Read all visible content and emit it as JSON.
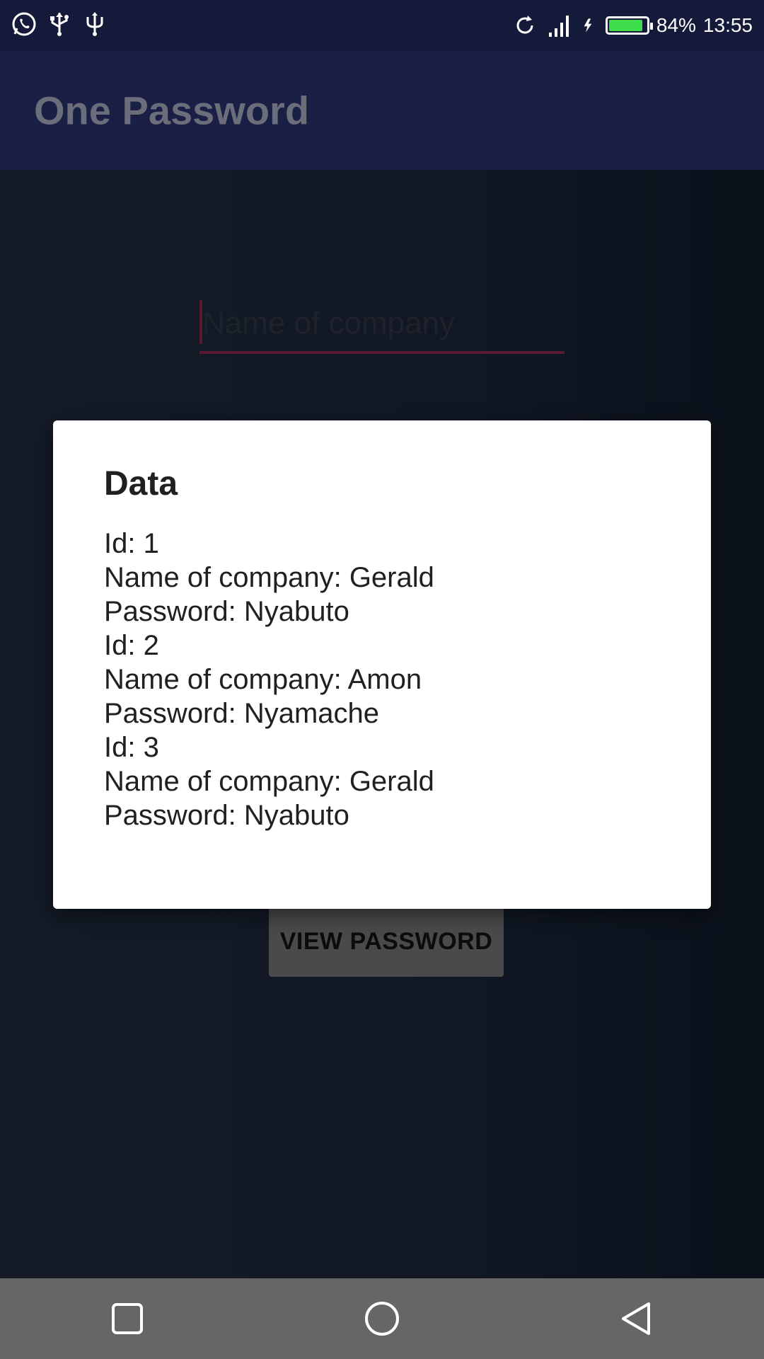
{
  "status_bar": {
    "icons_left": [
      "whatsapp-icon",
      "usb-icon",
      "usb-icon"
    ],
    "battery_percent": 84,
    "battery_label": "84%",
    "time": "13:55",
    "battery_color": "#3ddc4a"
  },
  "app_bar": {
    "title": "One Password",
    "color": "#1a1f45"
  },
  "form": {
    "company_placeholder": "Name of company",
    "company_value": "",
    "view_button_label": "VIEW PASSWORD"
  },
  "dialog": {
    "title": "Data",
    "lines": [
      "Id: 1",
      "Name of company: Gerald",
      "Password: Nyabuto",
      "Id: 2",
      "Name of company: Amon",
      "Password: Nyamache",
      "Id: 3",
      "Name of company: Gerald",
      "Password: Nyabuto"
    ]
  },
  "nav_bar": {
    "buttons": [
      "recents-icon",
      "home-icon",
      "back-icon"
    ]
  }
}
